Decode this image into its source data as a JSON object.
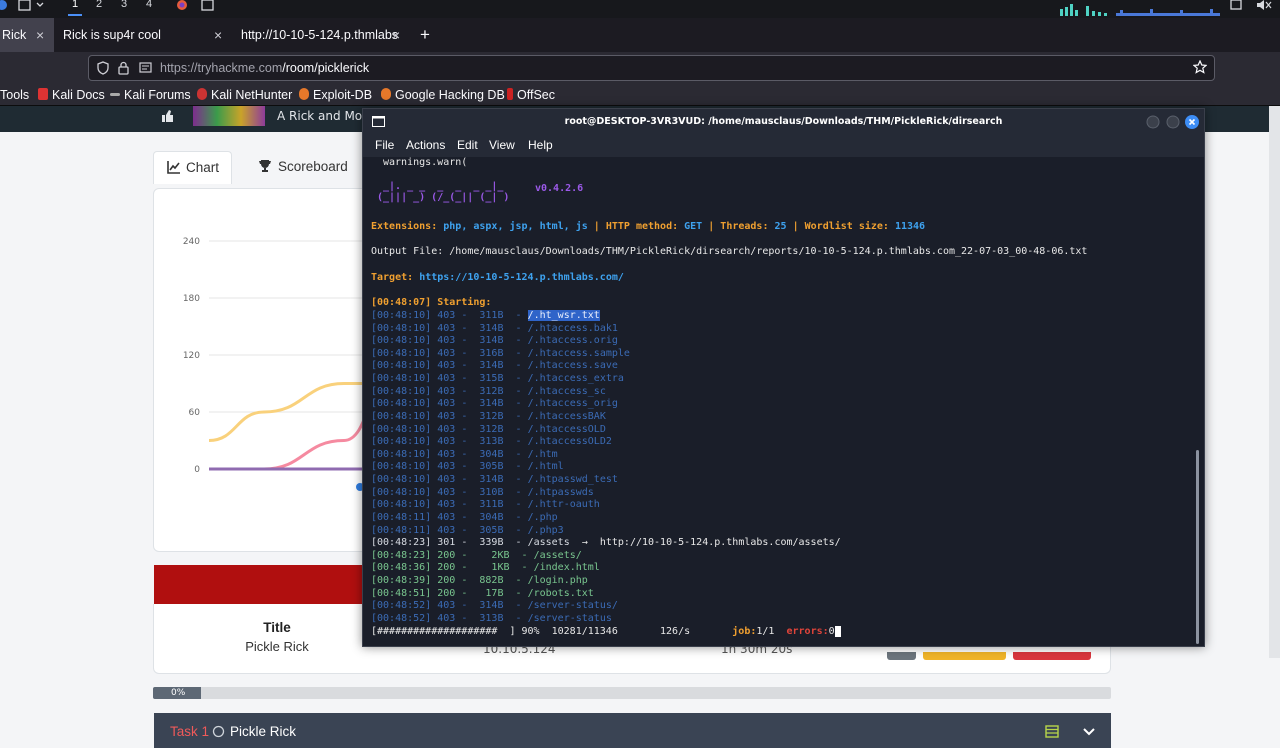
{
  "system_bar": {
    "workspaces": [
      "1",
      "2",
      "3",
      "4"
    ],
    "active_workspace": "1"
  },
  "browser": {
    "tabs": [
      {
        "label": "Rick",
        "active": true
      },
      {
        "label": "Rick is sup4r cool",
        "active": false
      },
      {
        "label": "http://10-10-5-124.p.thmlabs",
        "active": false
      }
    ],
    "new_tab": "+",
    "close_glyph": "×",
    "url_host": "https://tryhackme.com",
    "url_path": "/room/picklerick",
    "bookmarks": [
      "Tools",
      "Kali Docs",
      "Kali Forums",
      "Kali NetHunter",
      "Exploit-DB",
      "Google Hacking DB",
      "OffSec"
    ]
  },
  "page": {
    "banner_text": "A Rick and Mo",
    "tabs": [
      {
        "label": "Chart",
        "icon": "chart-line-icon"
      },
      {
        "label": "Scoreboard",
        "icon": "trophy-icon"
      }
    ],
    "chart_data": {
      "type": "line",
      "y_ticks": [
        "240",
        "180",
        "120",
        "60",
        "0"
      ],
      "ylim": [
        0,
        240
      ],
      "series": [
        {
          "color": "#f9d17c",
          "values": [
            30,
            60,
            90,
            90,
            90
          ]
        },
        {
          "color": "#f58aa0",
          "values": [
            0,
            0,
            30,
            100,
            190
          ]
        },
        {
          "color": "#8f6bb0",
          "values": [
            0,
            0,
            0,
            0,
            0
          ]
        }
      ]
    },
    "info": {
      "title_label": "Title",
      "title_value": "Pickle Rick",
      "ip_value": "10.10.5.124",
      "time_value": "1h 30m 20s"
    },
    "progress": {
      "value": 0.05,
      "label": "0%"
    },
    "task": {
      "number": "Task 1",
      "name": "Pickle Rick"
    }
  },
  "terminal": {
    "title": "root@DESKTOP-3VR3VUD: /home/mausclaus/Downloads/THM/PickleRick/dirsearch",
    "menu": [
      "File",
      "Actions",
      "Edit",
      "View",
      "Help"
    ],
    "warn_line": "warnings.warn(",
    "logo_line1": " _|. _ _  _  _  _ _|_",
    "logo_line2": "(_||| _) (/_(_|| (_| )",
    "version": "v0.4.2.6",
    "config": {
      "extensions_label": "Extensions:",
      "extensions": "php, aspx, jsp, html, js",
      "method_label": "HTTP method:",
      "method": "GET",
      "threads_label": "Threads:",
      "threads": "25",
      "wordlist_label": "Wordlist size:",
      "wordlist": "11346",
      "sep": "|"
    },
    "output_file": "Output File: /home/mausclaus/Downloads/THM/PickleRick/dirsearch/reports/10-10-5-124.p.thmlabs.com_22-07-03_00-48-06.txt",
    "target_label": "Target:",
    "target_url": "https://10-10-5-124.p.thmlabs.com/",
    "starting": "[00:48:07] Starting:",
    "results": [
      {
        "time": "[00:48:10]",
        "code": "403",
        "size": " 311B",
        "path": "/.ht_wsr.txt",
        "selected": true
      },
      {
        "time": "[00:48:10]",
        "code": "403",
        "size": " 314B",
        "path": "/.htaccess.bak1"
      },
      {
        "time": "[00:48:10]",
        "code": "403",
        "size": " 314B",
        "path": "/.htaccess.orig"
      },
      {
        "time": "[00:48:10]",
        "code": "403",
        "size": " 316B",
        "path": "/.htaccess.sample"
      },
      {
        "time": "[00:48:10]",
        "code": "403",
        "size": " 314B",
        "path": "/.htaccess.save"
      },
      {
        "time": "[00:48:10]",
        "code": "403",
        "size": " 315B",
        "path": "/.htaccess_extra"
      },
      {
        "time": "[00:48:10]",
        "code": "403",
        "size": " 312B",
        "path": "/.htaccess_sc"
      },
      {
        "time": "[00:48:10]",
        "code": "403",
        "size": " 314B",
        "path": "/.htaccess_orig"
      },
      {
        "time": "[00:48:10]",
        "code": "403",
        "size": " 312B",
        "path": "/.htaccessBAK"
      },
      {
        "time": "[00:48:10]",
        "code": "403",
        "size": " 312B",
        "path": "/.htaccessOLD"
      },
      {
        "time": "[00:48:10]",
        "code": "403",
        "size": " 313B",
        "path": "/.htaccessOLD2"
      },
      {
        "time": "[00:48:10]",
        "code": "403",
        "size": " 304B",
        "path": "/.htm"
      },
      {
        "time": "[00:48:10]",
        "code": "403",
        "size": " 305B",
        "path": "/.html"
      },
      {
        "time": "[00:48:10]",
        "code": "403",
        "size": " 314B",
        "path": "/.htpasswd_test"
      },
      {
        "time": "[00:48:10]",
        "code": "403",
        "size": " 310B",
        "path": "/.htpasswds"
      },
      {
        "time": "[00:48:10]",
        "code": "403",
        "size": " 311B",
        "path": "/.httr-oauth"
      },
      {
        "time": "[00:48:11]",
        "code": "403",
        "size": " 304B",
        "path": "/.php"
      },
      {
        "time": "[00:48:11]",
        "code": "403",
        "size": " 305B",
        "path": "/.php3"
      },
      {
        "time": "[00:48:23]",
        "code": "301",
        "size": " 339B",
        "path": "/assets",
        "redirect": "http://10-10-5-124.p.thmlabs.com/assets/"
      },
      {
        "time": "[00:48:23]",
        "code": "200",
        "size": "   2KB",
        "path": "/assets/"
      },
      {
        "time": "[00:48:36]",
        "code": "200",
        "size": "   1KB",
        "path": "/index.html"
      },
      {
        "time": "[00:48:39]",
        "code": "200",
        "size": " 882B",
        "path": "/login.php"
      },
      {
        "time": "[00:48:51]",
        "code": "200",
        "size": "  17B",
        "path": "/robots.txt"
      },
      {
        "time": "[00:48:52]",
        "code": "403",
        "size": " 314B",
        "path": "/server-status/"
      },
      {
        "time": "[00:48:52]",
        "code": "403",
        "size": " 313B",
        "path": "/server-status"
      }
    ],
    "progress_bar": "[####################  ] 90%",
    "progress_count": "10281/11346",
    "rate": "126/s",
    "job_label": "job:",
    "job_value": "1/1",
    "errors_label": "errors:",
    "errors_value": "0"
  }
}
